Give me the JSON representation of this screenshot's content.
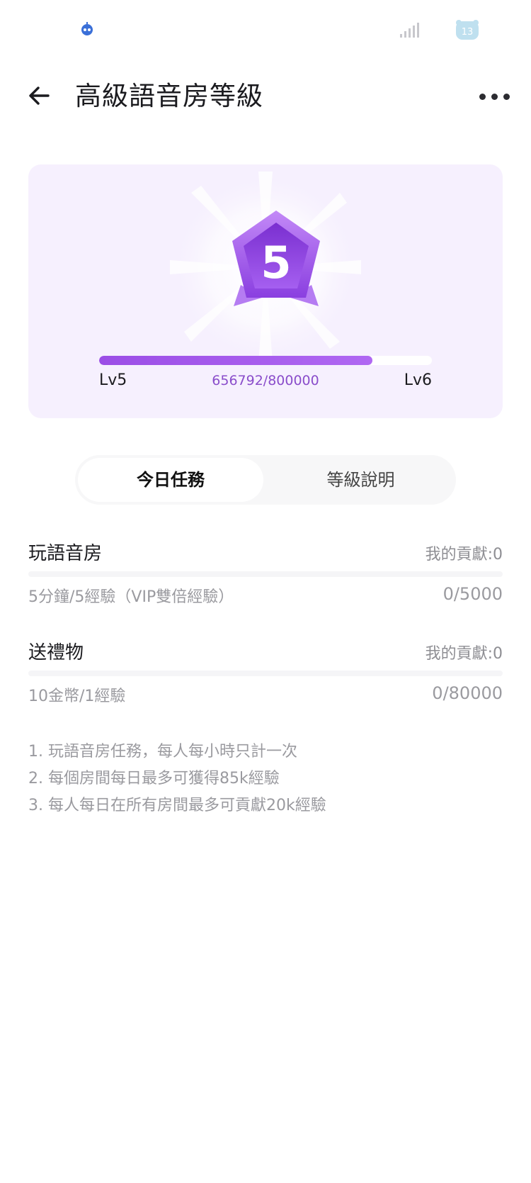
{
  "status_bar": {
    "battery_level": "13"
  },
  "header": {
    "title": "高級語音房等級"
  },
  "level_card": {
    "current_level": "5",
    "current_label": "Lv5",
    "next_label": "Lv6",
    "exp_text": "656792/800000",
    "progress_fraction": 0.821
  },
  "tabs": [
    {
      "label": "今日任務",
      "active": true
    },
    {
      "label": "等級說明",
      "active": false
    }
  ],
  "tasks": [
    {
      "title": "玩語音房",
      "contribution": "我的貢獻:0",
      "description": "5分鐘/5經驗（VIP雙倍經驗）",
      "progress": "0/5000"
    },
    {
      "title": "送禮物",
      "contribution": "我的貢獻:0",
      "description": "10金幣/1經驗",
      "progress": "0/80000"
    }
  ],
  "notes": [
    "1. 玩語音房任務，每人每小時只計一次",
    "2. 每個房間每日最多可獲得85k經驗",
    "3. 每人每日在所有房間最多可貢獻20k經驗"
  ],
  "colors": {
    "accent": "#9b4ee6",
    "card_bg": "#f6f0fe"
  },
  "icons": [
    "robot-icon",
    "signal-icon",
    "battery-icon",
    "back-arrow-icon",
    "more-icon",
    "level-badge-icon"
  ]
}
